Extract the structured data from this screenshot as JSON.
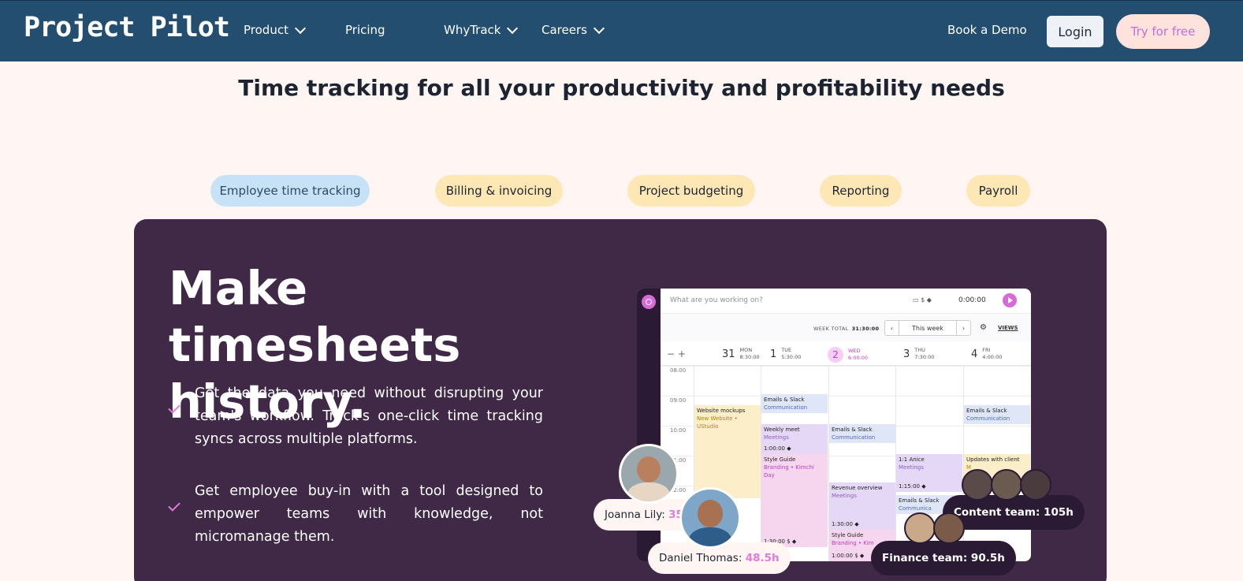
{
  "nav": {
    "logo": "Project Pilot",
    "items": [
      {
        "label": "Product",
        "dropdown": true
      },
      {
        "label": "Pricing",
        "dropdown": false
      },
      {
        "label": "WhyTrack",
        "dropdown": true
      },
      {
        "label": "Careers",
        "dropdown": true
      }
    ],
    "demo": "Book a Demo",
    "login": "Login",
    "try": "Try for free"
  },
  "headline": "Time tracking for all your productivity and profitability needs",
  "tabs": [
    {
      "label": "Employee time tracking",
      "active": true
    },
    {
      "label": "Billing & invoicing",
      "active": false
    },
    {
      "label": "Project budgeting",
      "active": false
    },
    {
      "label": "Reporting",
      "active": false
    },
    {
      "label": "Payroll",
      "active": false
    }
  ],
  "hero": {
    "title_line1": "Make timesheets",
    "title_line2": "history.",
    "bullets": [
      "Get the data you need without disrupting your team's workflow. Track's one-click time tracking syncs across multiple platforms.",
      "Get employee buy-in with a tool designed to empower teams with knowledge, not micromanage them."
    ]
  },
  "app": {
    "search_placeholder": "What are you working on?",
    "icons": "▭  $  ◆",
    "timer": "0:00:00",
    "week_total_label": "WEEK TOTAL",
    "week_total_value": "31:30:00",
    "week_nav": {
      "prev": "‹",
      "label": "This week",
      "next": "›"
    },
    "views": "VIEWS",
    "gear": "⚙",
    "zoom": "−  +",
    "days": [
      {
        "num": "31",
        "name": "MON",
        "total": "8:30:00",
        "today": false
      },
      {
        "num": "1",
        "name": "TUE",
        "total": "5:30:00",
        "today": false
      },
      {
        "num": "2",
        "name": "WED",
        "total": "6:00:00",
        "today": true
      },
      {
        "num": "3",
        "name": "THU",
        "total": "7:30:00",
        "today": false
      },
      {
        "num": "4",
        "name": "FRI",
        "total": "4:00:00",
        "today": false
      }
    ],
    "hours": [
      "08:00",
      "09:00",
      "10:00",
      "11:00",
      "12:00"
    ],
    "events": [
      {
        "title": "Website mockups",
        "sub": "New Website • UStudio",
        "foot": "",
        "color": "yellow"
      },
      {
        "title": "Emails & Slack",
        "sub": "Communication",
        "foot": "",
        "color": "blue"
      },
      {
        "title": "Weekly meet",
        "sub": "Meetings",
        "foot": "1:00:00 ◆",
        "color": "purple"
      },
      {
        "title": "Style Guide",
        "sub": "Branding • Kimchi Day",
        "foot": "1:30:00 $ ◆",
        "color": "pink"
      },
      {
        "title": "Emails & Slack",
        "sub": "Communication",
        "foot": "",
        "color": "blue"
      },
      {
        "title": "Revenue overview",
        "sub": "Meetings",
        "foot": "1:30:00 ◆",
        "color": "purple"
      },
      {
        "title": "Style Guide",
        "sub": "Branding • Kim",
        "foot": "1:00:00 $ ◆",
        "color": "pink"
      },
      {
        "title": "1:1 Anice",
        "sub": "Meetings",
        "foot": "1:15:00 ◆",
        "color": "purple"
      },
      {
        "title": "Emails & Slack",
        "sub": "Communica",
        "foot": "",
        "color": "blue"
      },
      {
        "title": "Emails & Slack",
        "sub": "Communication",
        "foot": "",
        "color": "blue"
      },
      {
        "title": "Updates with client",
        "sub": "M",
        "foot": "",
        "color": "yellow"
      }
    ]
  },
  "badges": {
    "joanna": {
      "name": "Joanna Lily:",
      "value": "35"
    },
    "daniel": {
      "name": "Daniel Thomas:",
      "value": "48.5h"
    },
    "content": "Content team: 105h",
    "finance": "Finance team: 90.5h"
  },
  "colors": {
    "nav": "#234e70",
    "panel": "#3f2947",
    "accent": "#e07bd6",
    "page_bg": "#fff5f2"
  }
}
